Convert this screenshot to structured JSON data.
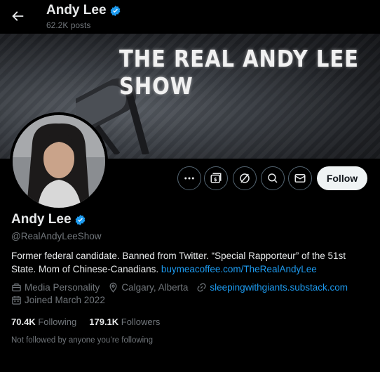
{
  "header": {
    "name": "Andy Lee",
    "post_count": "62.2K posts"
  },
  "banner": {
    "text": "THE REAL ANDY LEE SHOW"
  },
  "actions": {
    "more_icon": "more-icon",
    "subscribe_icon": "subscribe-icon",
    "grok_icon": "grok-icon",
    "search_icon": "search-icon",
    "message_icon": "message-icon",
    "follow_label": "Follow"
  },
  "profile": {
    "name": "Andy Lee",
    "handle": "@RealAndyLeeShow",
    "bio_text": "Former federal candidate. Banned from Twitter. “Special Rapporteur” of the 51st State. Mom of Chinese-Canadians. ",
    "bio_link": "buymeacoffee.com/TheRealAndyLee",
    "category": "Media Personality",
    "location": "Calgary, Alberta",
    "website": "sleepingwithgiants.substack.com",
    "joined": "Joined March 2022"
  },
  "stats": {
    "following_count": "70.4K",
    "following_label": "Following",
    "followers_count": "179.1K",
    "followers_label": "Followers"
  },
  "not_followed_text": "Not followed by anyone you’re following",
  "colors": {
    "accent": "#1d9bf0",
    "background": "#000000",
    "muted": "#71767b"
  }
}
